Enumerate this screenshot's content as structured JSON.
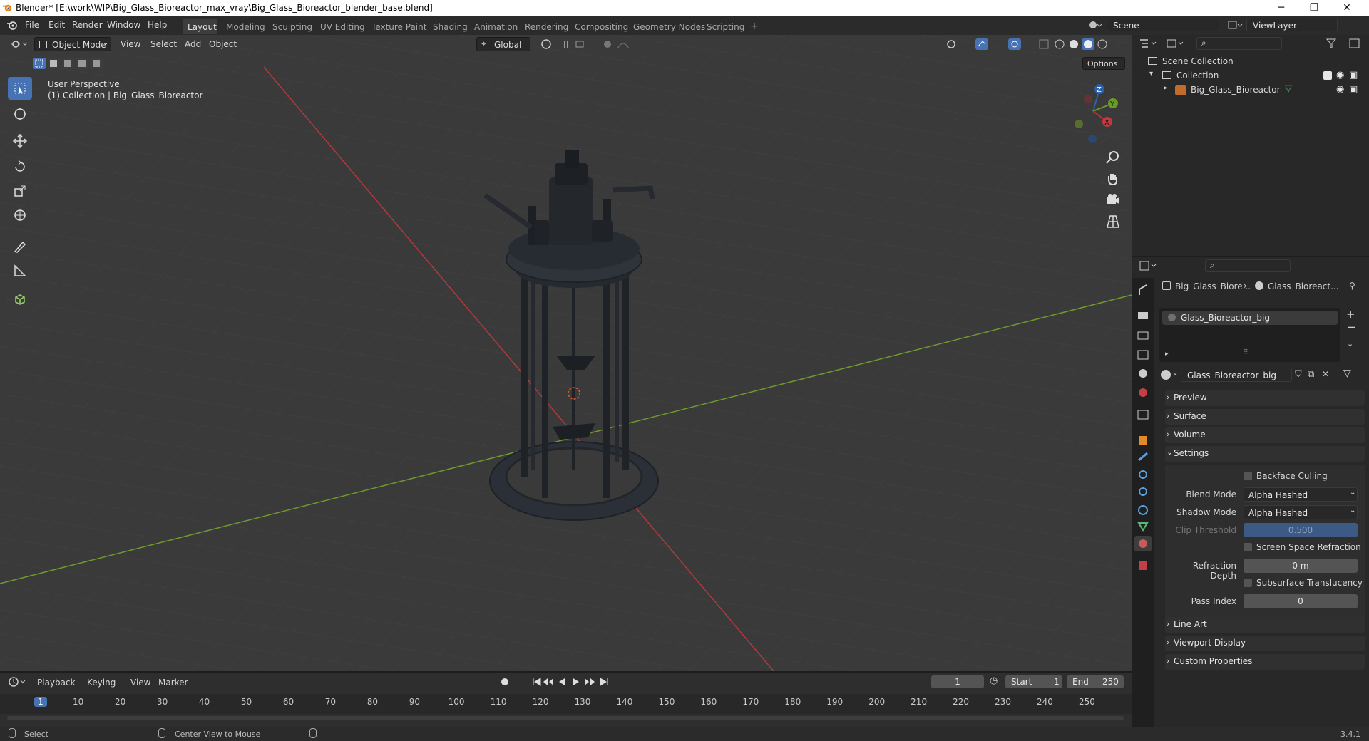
{
  "window": {
    "title": "Blender* [E:\\work\\WIP\\Big_Glass_Bioreactor_max_vray\\Big_Glass_Bioreactor_blender_base.blend]",
    "minimize": "─",
    "maximize": "❐",
    "close": "✕"
  },
  "menubar": {
    "items": [
      "File",
      "Edit",
      "Render",
      "Window",
      "Help"
    ]
  },
  "workspaces": {
    "tabs": [
      "Layout",
      "Modeling",
      "Sculpting",
      "UV Editing",
      "Texture Paint",
      "Shading",
      "Animation",
      "Rendering",
      "Compositing",
      "Geometry Nodes",
      "Scripting"
    ],
    "add": "+",
    "active": "Layout"
  },
  "scene": {
    "name": "Scene",
    "view_layer": "ViewLayer"
  },
  "viewport_header": {
    "mode": "Object Mode",
    "menus": [
      "View",
      "Select",
      "Add",
      "Object"
    ],
    "orientation": "Global",
    "options": "Options"
  },
  "viewport": {
    "perspective": "User Perspective",
    "collection_info": "(1) Collection | Big_Glass_Bioreactor",
    "gizmo": {
      "x": "X",
      "y": "Y",
      "z": "Z"
    }
  },
  "outliner": {
    "items": [
      {
        "label": "Scene Collection"
      },
      {
        "label": "Collection"
      },
      {
        "label": "Big_Glass_Bioreactor"
      }
    ]
  },
  "properties": {
    "breadcrumb_object": "Big_Glass_Biore...",
    "breadcrumb_material": "Glass_Bioreact...",
    "slot_name": "Glass_Bioreactor_big",
    "material_name": "Glass_Bioreactor_big",
    "panels_top": [
      "Preview",
      "Surface",
      "Volume",
      "Settings"
    ],
    "settings": {
      "backface_culling": "Backface Culling",
      "blend_mode_label": "Blend Mode",
      "blend_mode_value": "Alpha Hashed",
      "shadow_mode_label": "Shadow Mode",
      "shadow_mode_value": "Alpha Hashed",
      "clip_threshold_label": "Clip Threshold",
      "clip_threshold_value": "0.500",
      "ssr": "Screen Space Refraction",
      "refraction_depth_label": "Refraction Depth",
      "refraction_depth_value": "0 m",
      "subsurface": "Subsurface Translucency",
      "pass_index_label": "Pass Index",
      "pass_index_value": "0"
    },
    "panels_bottom": [
      "Line Art",
      "Viewport Display",
      "Custom Properties"
    ]
  },
  "timeline": {
    "menus": [
      "Playback",
      "Keying",
      "View",
      "Marker"
    ],
    "current_frame": "1",
    "start_label": "Start",
    "start_value": "1",
    "end_label": "End",
    "end_value": "250",
    "ticks": [
      "1",
      "10",
      "20",
      "30",
      "40",
      "50",
      "60",
      "70",
      "80",
      "90",
      "100",
      "110",
      "120",
      "130",
      "140",
      "150",
      "160",
      "170",
      "180",
      "190",
      "200",
      "210",
      "220",
      "230",
      "240",
      "250"
    ]
  },
  "statusbar": {
    "select": "Select",
    "center_view": "Center View to Mouse",
    "version": "3.4.1"
  },
  "colors": {
    "accent": "#4772b3",
    "grid": "#3a3a3a",
    "x_axis": "#b5383c",
    "y_axis": "#6f9a2c",
    "object": "#2a2e33"
  }
}
